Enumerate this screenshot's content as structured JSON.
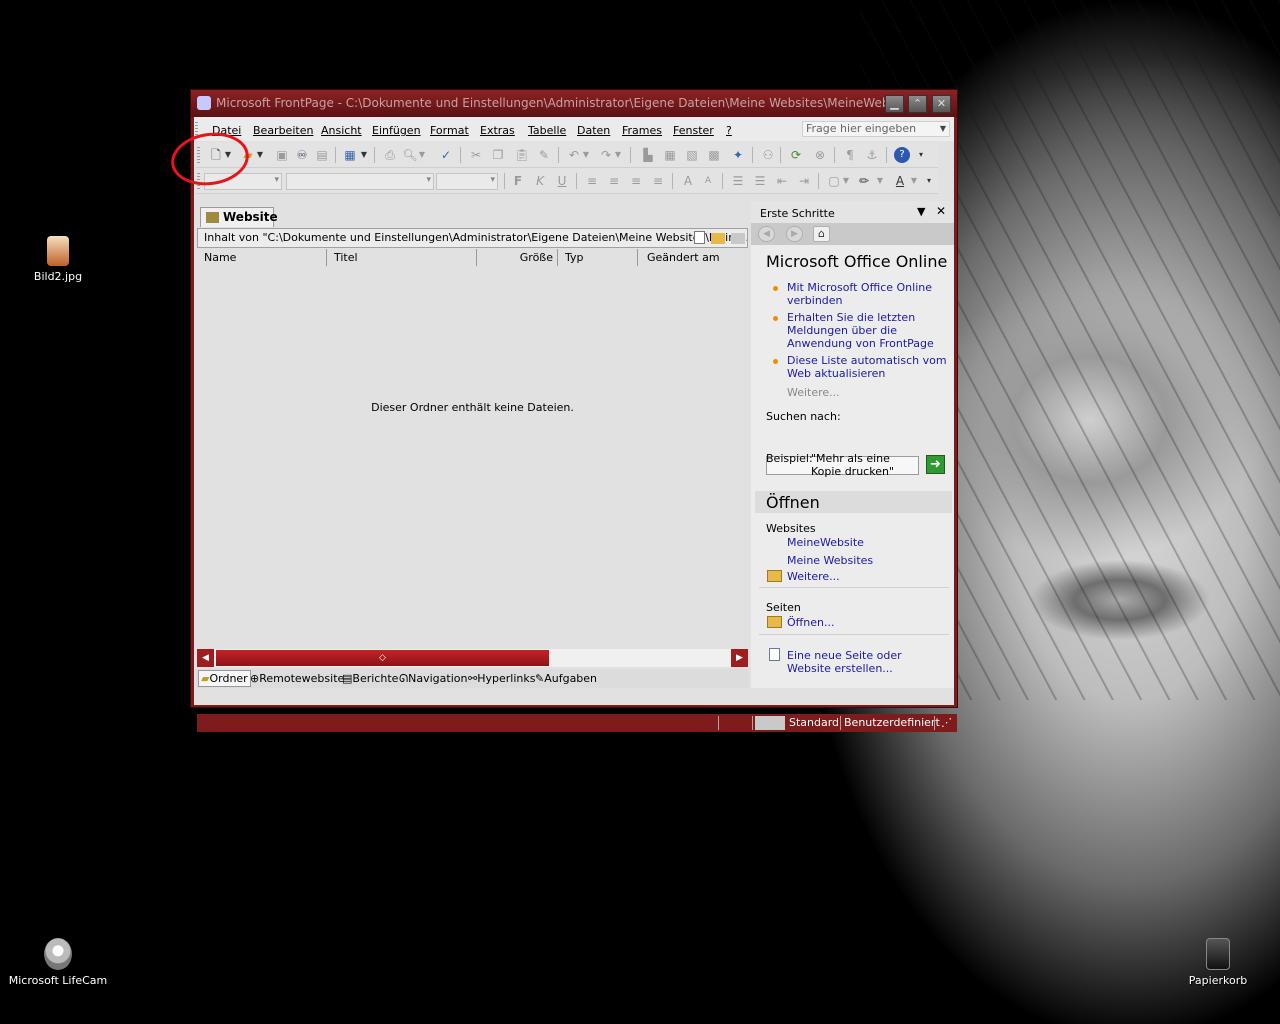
{
  "desktop": {
    "icons": [
      {
        "label": "Bild2.jpg",
        "icon": "image-file-icon"
      },
      {
        "label": "Microsoft LifeCam",
        "icon": "webcam-icon"
      },
      {
        "label": "Papierkorb",
        "icon": "recycle-bin-icon"
      }
    ]
  },
  "window": {
    "title": "Microsoft FrontPage - C:\\Dokumente und Einstellungen\\Administrator\\Eigene Dateien\\Meine Websites\\MeineWebsite",
    "controls": [
      "minimize-icon",
      "restore-icon",
      "close-icon"
    ]
  },
  "menu": {
    "items": [
      "Datei",
      "Bearbeiten",
      "Ansicht",
      "Einfügen",
      "Format",
      "Extras",
      "Tabelle",
      "Daten",
      "Frames",
      "Fenster",
      "?"
    ],
    "ask_placeholder": "Frage hier eingeben"
  },
  "website_view": {
    "tab_label": "Website",
    "path": "Inhalt von \"C:\\Dokumente und Einstellungen\\Administrator\\Eigene Dateien\\Meine Websites\\Meine...",
    "columns": [
      "Name",
      "Titel",
      "Größe",
      "Typ",
      "Geändert am"
    ],
    "empty_message": "Dieser Ordner enthält keine Dateien.",
    "scroll_thumb_glyph": "◇"
  },
  "view_tabs": [
    "Ordner",
    "Remotewebsite",
    "Berichte",
    "Navigation",
    "Hyperlinks",
    "Aufgaben"
  ],
  "task_pane": {
    "title": "Erste Schritte",
    "online_title": "Microsoft Office Online",
    "online_links": [
      "Mit Microsoft Office Online verbinden",
      "Erhalten Sie die letzten Meldungen über die Anwendung von FrontPage",
      "Diese Liste automatisch vom Web aktualisieren"
    ],
    "more_disabled": "Weitere...",
    "search_label": "Suchen nach:",
    "example_label": "Beispiel:",
    "example_text": "\"Mehr als eine Kopie drucken\"",
    "open_title": "Öffnen",
    "websites_label": "Websites",
    "website_links": [
      "MeineWebsite",
      "Meine Websites"
    ],
    "websites_more": "Weitere...",
    "pages_label": "Seiten",
    "pages_open": "Öffnen...",
    "new_link": "Eine neue Seite oder Website erstellen..."
  },
  "status": {
    "mode": "Standard",
    "custom": "Benutzerdefiniert"
  },
  "annotation": {
    "color": "#e8141b"
  }
}
